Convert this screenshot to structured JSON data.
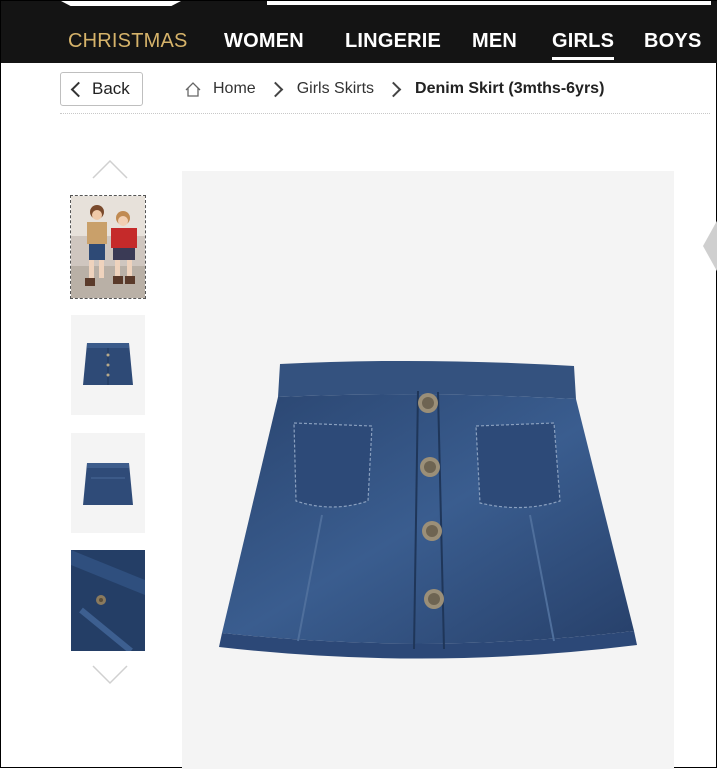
{
  "nav": {
    "items": [
      {
        "label": "CHRISTMAS"
      },
      {
        "label": "WOMEN"
      },
      {
        "label": "LINGERIE"
      },
      {
        "label": "MEN"
      },
      {
        "label": "GIRLS"
      },
      {
        "label": "BOYS"
      }
    ],
    "selected": "GIRLS"
  },
  "breadcrumb": {
    "back_label": "Back",
    "home": "Home",
    "category": "Girls Skirts",
    "current": "Denim Skirt (3mths-6yrs)"
  },
  "colors": {
    "nav_bg": "#141414",
    "holiday_accent": "#d6b36a",
    "denim": "#2e4a76",
    "image_bg": "#f4f4f4"
  },
  "icons": [
    "home-icon",
    "chevron-right-icon",
    "chevron-left-icon",
    "chevron-up-icon",
    "chevron-down-icon"
  ]
}
